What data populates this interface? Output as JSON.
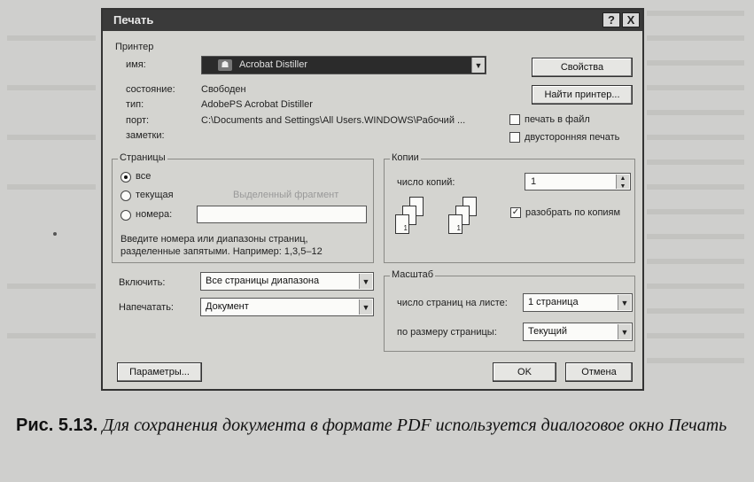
{
  "dialog": {
    "title": "Печать",
    "help_symbol": "?",
    "close_symbol": "X"
  },
  "printer": {
    "group_label": "Принтер",
    "name_label": "имя:",
    "name_value": "Acrobat Distiller",
    "status_label": "состояние:",
    "status_value": "Свободен",
    "type_label": "тип:",
    "type_value": "AdobePS Acrobat Distiller",
    "port_label": "порт:",
    "port_value": "C:\\Documents and Settings\\All Users.WINDOWS\\Рабочий ...",
    "comment_label": "заметки:",
    "properties_button": "Свойства",
    "find_printer_button": "Найти принтер...",
    "print_to_file_label": "печать в файл",
    "print_to_file_checked": false,
    "duplex_label": "двусторонняя печать",
    "duplex_checked": false
  },
  "pages": {
    "group_label": "Страницы",
    "all_label": "все",
    "current_label": "текущая",
    "selection_label": "Выделенный фрагмент",
    "numbers_label": "номера:",
    "numbers_value": "",
    "hint": "Введите номера или диапазоны страниц, разделенные запятыми. Например: 1,3,5–12",
    "selected": "all"
  },
  "copies": {
    "group_label": "Копии",
    "count_label": "число копий:",
    "count_value": "1",
    "collate_label": "разобрать по копиям",
    "collate_checked": true
  },
  "include": {
    "label": "Включить:",
    "value": "Все страницы диапазона"
  },
  "print_what": {
    "label": "Напечатать:",
    "value": "Документ"
  },
  "zoom": {
    "group_label": "Масштаб",
    "pages_per_sheet_label": "число страниц на листе:",
    "pages_per_sheet_value": "1 страница",
    "scale_to_label": "по размеру страницы:",
    "scale_to_value": "Текущий"
  },
  "buttons": {
    "options": "Параметры...",
    "ok": "OK",
    "cancel": "Отмена"
  },
  "caption": {
    "number": "Рис. 5.13.",
    "text": "Для сохранения документа в формате PDF используется диалоговое окно Печать"
  }
}
